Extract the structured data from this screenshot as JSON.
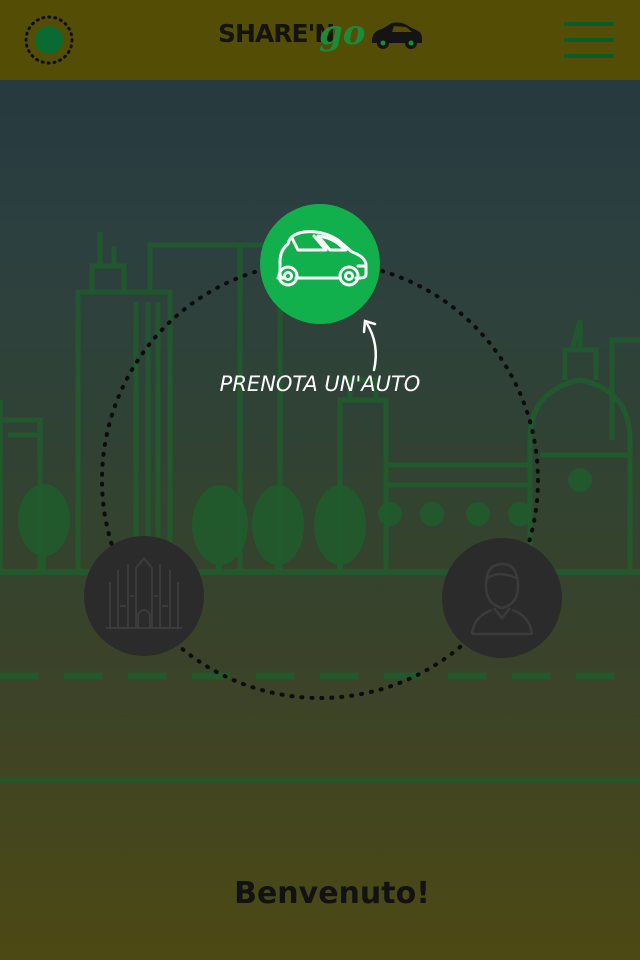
{
  "header": {
    "logo": {
      "text_share": "SHARE'N",
      "text_go": "go"
    },
    "location_icon": "location-target-icon",
    "menu_icon": "hamburger-menu-icon"
  },
  "main": {
    "book_car": {
      "label": "PRENOTA UN'AUTO",
      "icon": "car-icon"
    },
    "city_button": {
      "icon": "duomo-cathedral-icon"
    },
    "profile_button": {
      "icon": "user-profile-icon"
    },
    "welcome": "Benvenuto!"
  },
  "colors": {
    "header_bg": "#544d06",
    "accent_green": "#12b04c",
    "dark_circle": "#2c2b2b",
    "skyline_line": "#1f5f2a"
  }
}
